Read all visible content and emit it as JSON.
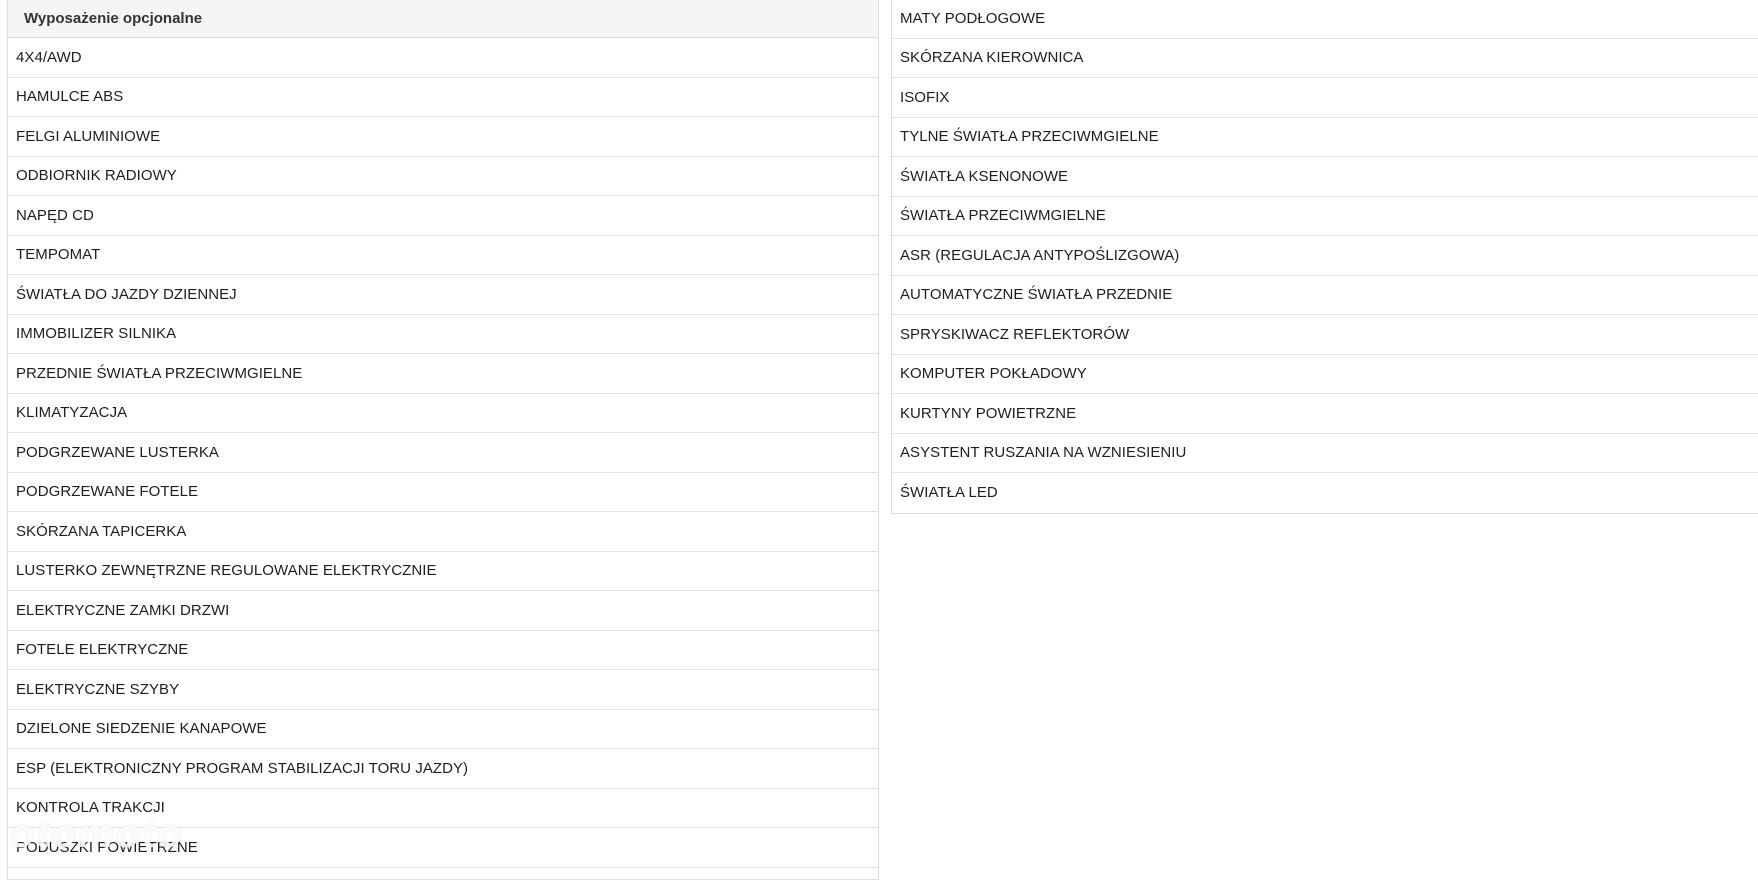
{
  "left_panel": {
    "heading": "Wyposażenie opcjonalne",
    "items": [
      "4X4/AWD",
      "HAMULCE ABS",
      "FELGI ALUMINIOWE",
      "ODBIORNIK RADIOWY",
      "NAPĘD CD",
      "TEMPOMAT",
      "ŚWIATŁA DO JAZDY DZIENNEJ",
      "IMMOBILIZER SILNIKA",
      "PRZEDNIE ŚWIATŁA PRZECIWMGIELNE",
      "KLIMATYZACJA",
      "PODGRZEWANE LUSTERKA",
      "PODGRZEWANE FOTELE",
      "SKÓRZANA TAPICERKA",
      "LUSTERKO ZEWNĘTRZNE REGULOWANE ELEKTRYCZNIE",
      "ELEKTRYCZNE ZAMKI DRZWI",
      "FOTELE ELEKTRYCZNE",
      "ELEKTRYCZNE SZYBY",
      "DZIELONE SIEDZENIE KANAPOWE",
      "ESP (ELEKTRONICZNY PROGRAM STABILIZACJI TORU JAZDY)",
      "KONTROLA TRAKCJI",
      "PODUSZKI POWIETRZNE"
    ]
  },
  "right_panel": {
    "items": [
      "MATY PODŁOGOWE",
      "SKÓRZANA KIEROWNICA",
      "ISOFIX",
      "TYLNE ŚWIATŁA PRZECIWMGIELNE",
      "ŚWIATŁA KSENONOWE",
      "ŚWIATŁA PRZECIWMGIELNE",
      "ASR (REGULACJA ANTYPOŚLIZGOWA)",
      "AUTOMATYCZNE ŚWIATŁA PRZEDNIE",
      "SPRYSKIWACZ REFLEKTORÓW",
      "KOMPUTER POKŁADOWY",
      "KURTYNY POWIETRZNE",
      "ASYSTENT RUSZANIA NA WZNIESIENIU",
      "ŚWIATŁA LED"
    ]
  },
  "watermark": {
    "text": "otomoto"
  }
}
